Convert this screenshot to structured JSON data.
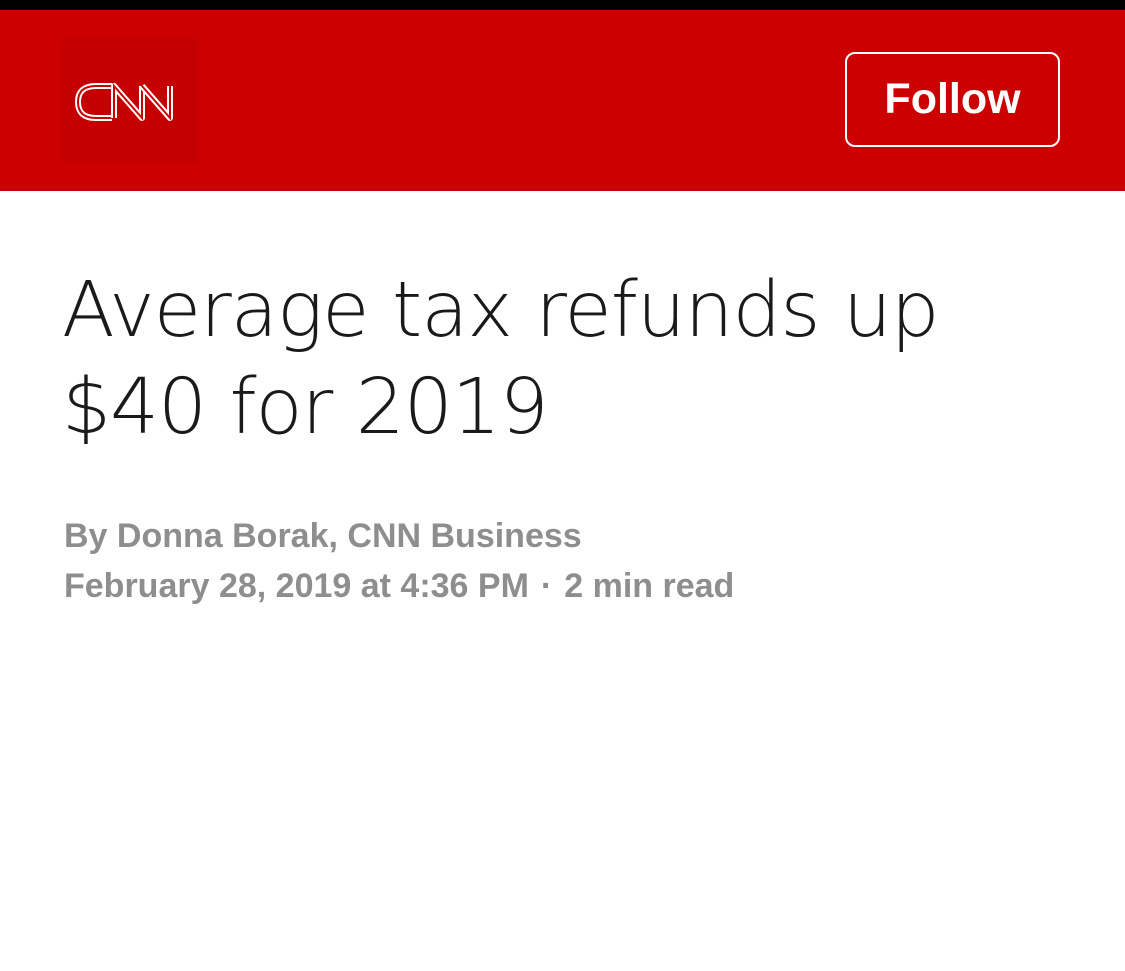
{
  "header": {
    "brand": "CNN",
    "follow_label": "Follow",
    "background_color": "#cc0000"
  },
  "article": {
    "headline": "Average tax refunds up $40 for 2019",
    "byline": "By Donna Borak, CNN Business",
    "date": "February 28, 2019 at 4:36 PM",
    "separator": "·",
    "read_time": "2 min read"
  }
}
